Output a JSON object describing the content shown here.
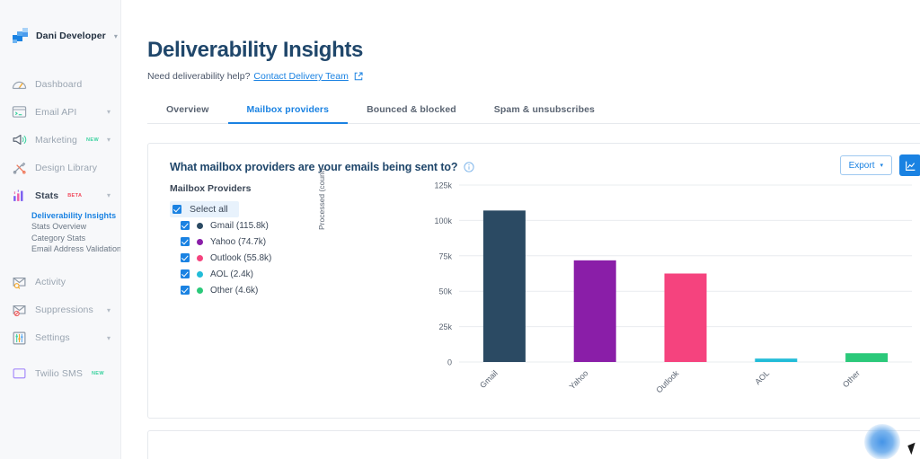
{
  "sidebar": {
    "account": {
      "name": "Dani Developer",
      "logo_icon": "mosaic-logo",
      "caret_icon": "chevron-down-icon"
    },
    "items": [
      {
        "label": "Dashboard",
        "icon": "gauge-icon",
        "badge": "",
        "caret": false,
        "active": false
      },
      {
        "label": "Email API",
        "icon": "terminal-icon",
        "badge": "",
        "caret": true,
        "active": false
      },
      {
        "label": "Marketing",
        "icon": "megaphone-icon",
        "badge": "NEW",
        "caret": true,
        "active": false
      },
      {
        "label": "Design Library",
        "icon": "design-tools-icon",
        "badge": "",
        "caret": false,
        "active": false
      },
      {
        "label": "Stats",
        "icon": "bar-chart-icon",
        "badge": "BETA",
        "caret": true,
        "active": true
      },
      {
        "label": "Activity",
        "icon": "envelope-search-icon",
        "badge": "",
        "caret": false,
        "active": false
      },
      {
        "label": "Suppressions",
        "icon": "envelope-block-icon",
        "badge": "",
        "caret": true,
        "active": false
      },
      {
        "label": "Settings",
        "icon": "sliders-icon",
        "badge": "",
        "caret": true,
        "active": false
      },
      {
        "label": "Twilio SMS",
        "icon": "message-icon",
        "badge": "NEW",
        "caret": false,
        "active": false
      }
    ],
    "stats_submenu": [
      {
        "label": "Deliverability Insights",
        "active": true
      },
      {
        "label": "Stats Overview",
        "active": false
      },
      {
        "label": "Category Stats",
        "active": false
      },
      {
        "label": "Email Address Validation",
        "active": false
      }
    ]
  },
  "header": {
    "title": "Deliverability Insights",
    "help_prefix": "Need deliverability help?",
    "help_link": "Contact Delivery Team",
    "external_icon": "external-link-icon"
  },
  "tabs": [
    {
      "label": "Overview",
      "active": false
    },
    {
      "label": "Mailbox providers",
      "active": true
    },
    {
      "label": "Bounced & blocked",
      "active": false
    },
    {
      "label": "Spam & unsubscribes",
      "active": false
    }
  ],
  "card": {
    "title": "What mailbox providers are your emails being sent to?",
    "info_icon": "info-circle-icon",
    "legend_heading": "Mailbox Providers",
    "select_all_label": "Select all",
    "export_label": "Export",
    "export_caret_icon": "chevron-down-icon",
    "chart_toggle_icon": "line-chart-icon"
  },
  "chart_data": {
    "type": "bar",
    "title": "What mailbox providers are your emails being sent to?",
    "categories": [
      "Gmail",
      "Yahoo",
      "Outlook",
      "AOL",
      "Other"
    ],
    "values": [
      107000,
      71800,
      62500,
      2400,
      6200
    ],
    "legend_values": [
      "115.8k",
      "74.7k",
      "55.8k",
      "2.4k",
      "4.6k"
    ],
    "colors": [
      "#2b4a63",
      "#8a1ea8",
      "#f5437e",
      "#22bcd8",
      "#2bc97a"
    ],
    "xlabel": "",
    "ylabel": "Processed (count)",
    "ylim": [
      0,
      125000
    ],
    "yticks": [
      0,
      25000,
      50000,
      75000,
      100000,
      125000
    ],
    "ytick_labels": [
      "0",
      "25k",
      "50k",
      "75k",
      "100k",
      "125k"
    ],
    "grid": true,
    "legend_position": "left",
    "xtick_rotation": -45
  }
}
